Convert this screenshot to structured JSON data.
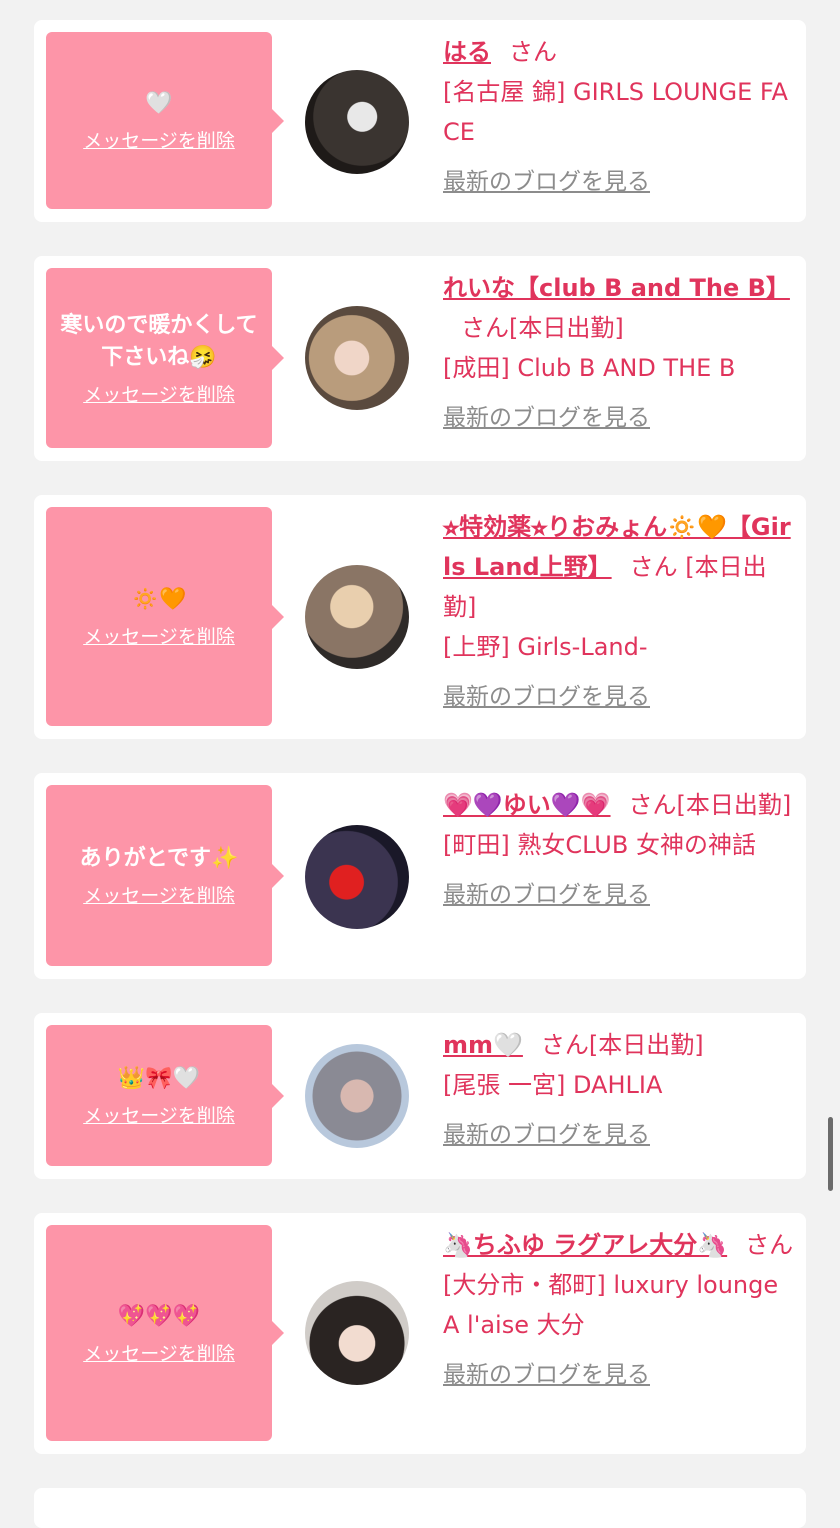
{
  "delete_label": "メッセージを削除",
  "blog_label": "最新のブログを見る",
  "san_label": "さん",
  "cards": [
    {
      "message": "🤍",
      "name": "はる",
      "status": "",
      "shop": "[名古屋 錦] GIRLS LOUNGE FACE"
    },
    {
      "message": "寒いので暖かくして下さいね🤧",
      "name": "れいな【club B and The B】",
      "status": "[本日出勤]",
      "shop": "[成田] Club B AND THE B"
    },
    {
      "message": "🔅🧡",
      "name": "⭐︎特効薬⭐︎りおみょん🔅🧡【Girls Land上野】",
      "status": "[本日出勤]",
      "shop": "[上野] Girls-Land-"
    },
    {
      "message": "ありがとです✨",
      "name": "💗💜ゆい💜💗",
      "status": "[本日出勤]",
      "shop": "[町田] 熟女CLUB 女神の神話"
    },
    {
      "message": "👑🎀🤍",
      "name": "mm🤍",
      "status": "[本日出勤]",
      "shop": "[尾張 一宮] DAHLIA"
    },
    {
      "message": "💖💖💖",
      "name": "🦄ちふゆ ラグアレ大分🦄",
      "status": "",
      "shop": "[大分市・都町] luxury lounge A l'aise 大分"
    }
  ],
  "colors": {
    "background": "#f2f2f2",
    "bubble": "#fd95a8",
    "accent": "#e0345c",
    "link_gray": "#8c8c8c"
  }
}
